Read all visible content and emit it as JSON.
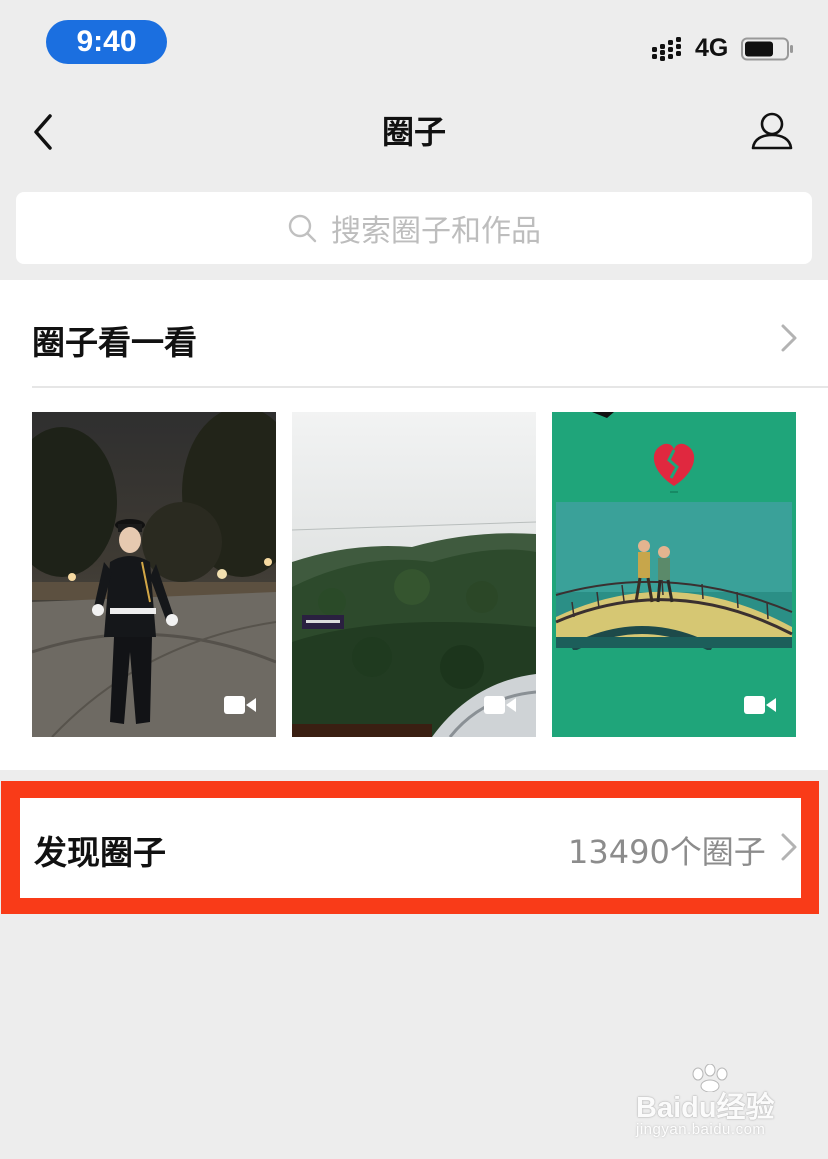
{
  "status_bar": {
    "time": "9:40",
    "network": "4G"
  },
  "nav": {
    "title": "圈子",
    "back_icon": "chevron-left-icon",
    "profile_icon": "person-icon"
  },
  "search": {
    "placeholder": "搜索圈子和作品",
    "icon": "search-icon"
  },
  "circles_section": {
    "title": "圈子看一看",
    "thumbnails": [
      {
        "subject": "honor guard soldier at night",
        "type": "video"
      },
      {
        "subject": "misty green mountain",
        "type": "video"
      },
      {
        "subject": "cartoon couple on bridge with broken heart",
        "type": "video"
      }
    ]
  },
  "discover": {
    "label": "发现圈子",
    "count": "13490个圈子"
  },
  "watermark": {
    "brand_text": "Baidu经验",
    "url": "jingyan.baidu.com"
  },
  "colors": {
    "time_pill": "#1b6fe0",
    "highlight_frame": "#f93b18",
    "background": "#ededed",
    "thumb3_bg": "#1fa57a"
  }
}
